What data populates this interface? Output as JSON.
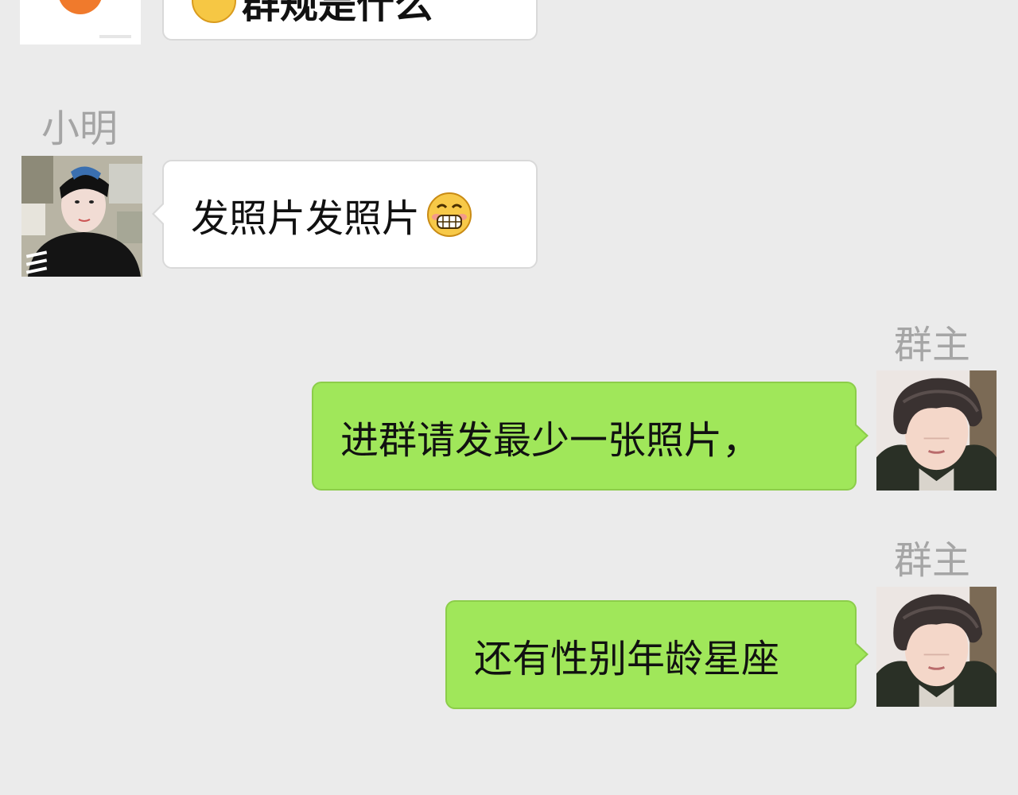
{
  "messages": [
    {
      "direction": "incoming",
      "sender": "",
      "text": "群规是什么",
      "emoji": "smiley-face-icon",
      "partially_visible": true
    },
    {
      "direction": "incoming",
      "sender": "小明",
      "text": "发照片发照片",
      "emoji": "grinning-face-icon"
    },
    {
      "direction": "outgoing",
      "sender": "群主",
      "text": "进群请发最少一张照片，"
    },
    {
      "direction": "outgoing",
      "sender": "群主",
      "text": "还有性别年龄星座"
    }
  ],
  "colors": {
    "background": "#ebebeb",
    "incoming_bubble": "#ffffff",
    "outgoing_bubble": "#a0e75a",
    "sender_name": "#a5a5a5"
  }
}
